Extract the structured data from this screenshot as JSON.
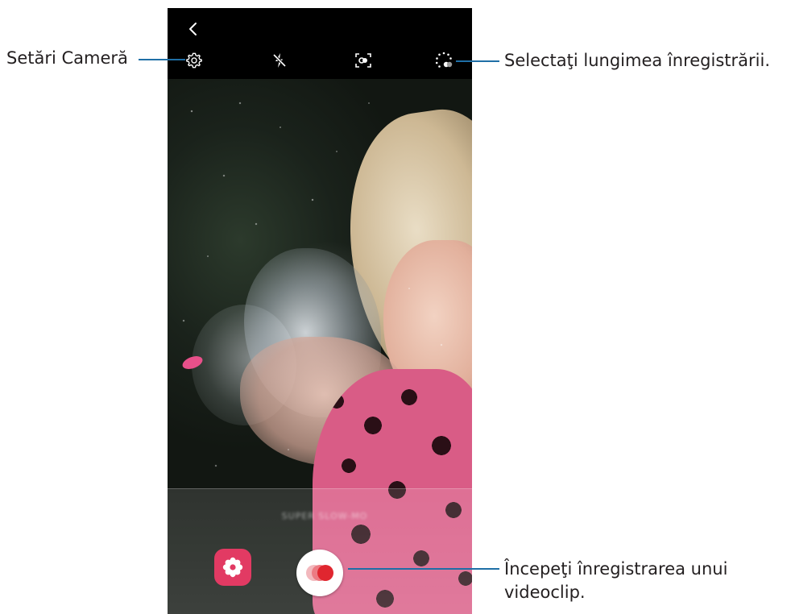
{
  "callouts": {
    "settings": "Setări Cameră",
    "duration": "Selectaţi lungimea înregistrării.",
    "record_line1": "Începeţi înregistrarea unui",
    "record_line2": "videoclip."
  },
  "viewfinder": {
    "overlay_text": "SUPER SLOW-MO"
  },
  "colors": {
    "leader_line": "#1f6fa6",
    "effect_button": "#e23a63",
    "record_dot": "#e0262f"
  },
  "icons": {
    "back": "back-arrow-icon",
    "settings": "gear-icon",
    "flash": "flash-off-icon",
    "detect": "motion-detection-icon",
    "duration": "recording-duration-icon",
    "effect": "flower-effect-icon",
    "record": "record-icon"
  }
}
